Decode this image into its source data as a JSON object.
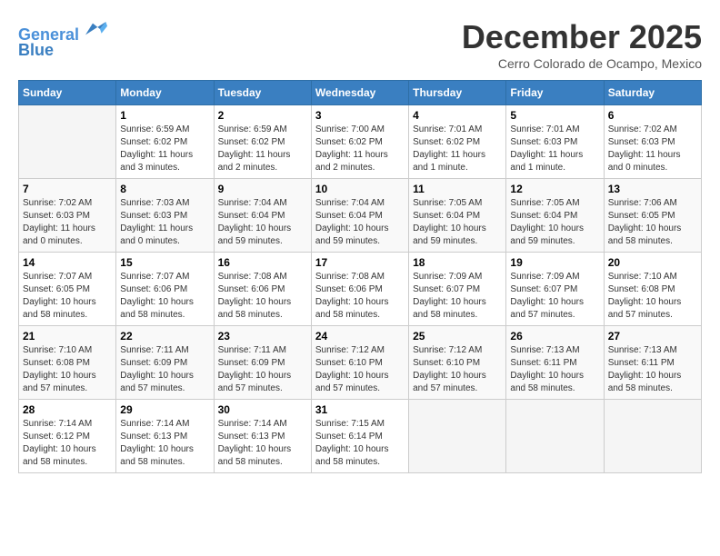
{
  "header": {
    "logo_line1": "General",
    "logo_line2": "Blue",
    "month": "December 2025",
    "location": "Cerro Colorado de Ocampo, Mexico"
  },
  "days_of_week": [
    "Sunday",
    "Monday",
    "Tuesday",
    "Wednesday",
    "Thursday",
    "Friday",
    "Saturday"
  ],
  "weeks": [
    [
      {
        "day": "",
        "sunrise": "",
        "sunset": "",
        "daylight": ""
      },
      {
        "day": "1",
        "sunrise": "Sunrise: 6:59 AM",
        "sunset": "Sunset: 6:02 PM",
        "daylight": "Daylight: 11 hours and 3 minutes."
      },
      {
        "day": "2",
        "sunrise": "Sunrise: 6:59 AM",
        "sunset": "Sunset: 6:02 PM",
        "daylight": "Daylight: 11 hours and 2 minutes."
      },
      {
        "day": "3",
        "sunrise": "Sunrise: 7:00 AM",
        "sunset": "Sunset: 6:02 PM",
        "daylight": "Daylight: 11 hours and 2 minutes."
      },
      {
        "day": "4",
        "sunrise": "Sunrise: 7:01 AM",
        "sunset": "Sunset: 6:02 PM",
        "daylight": "Daylight: 11 hours and 1 minute."
      },
      {
        "day": "5",
        "sunrise": "Sunrise: 7:01 AM",
        "sunset": "Sunset: 6:03 PM",
        "daylight": "Daylight: 11 hours and 1 minute."
      },
      {
        "day": "6",
        "sunrise": "Sunrise: 7:02 AM",
        "sunset": "Sunset: 6:03 PM",
        "daylight": "Daylight: 11 hours and 0 minutes."
      }
    ],
    [
      {
        "day": "7",
        "sunrise": "Sunrise: 7:02 AM",
        "sunset": "Sunset: 6:03 PM",
        "daylight": "Daylight: 11 hours and 0 minutes."
      },
      {
        "day": "8",
        "sunrise": "Sunrise: 7:03 AM",
        "sunset": "Sunset: 6:03 PM",
        "daylight": "Daylight: 11 hours and 0 minutes."
      },
      {
        "day": "9",
        "sunrise": "Sunrise: 7:04 AM",
        "sunset": "Sunset: 6:04 PM",
        "daylight": "Daylight: 10 hours and 59 minutes."
      },
      {
        "day": "10",
        "sunrise": "Sunrise: 7:04 AM",
        "sunset": "Sunset: 6:04 PM",
        "daylight": "Daylight: 10 hours and 59 minutes."
      },
      {
        "day": "11",
        "sunrise": "Sunrise: 7:05 AM",
        "sunset": "Sunset: 6:04 PM",
        "daylight": "Daylight: 10 hours and 59 minutes."
      },
      {
        "day": "12",
        "sunrise": "Sunrise: 7:05 AM",
        "sunset": "Sunset: 6:04 PM",
        "daylight": "Daylight: 10 hours and 59 minutes."
      },
      {
        "day": "13",
        "sunrise": "Sunrise: 7:06 AM",
        "sunset": "Sunset: 6:05 PM",
        "daylight": "Daylight: 10 hours and 58 minutes."
      }
    ],
    [
      {
        "day": "14",
        "sunrise": "Sunrise: 7:07 AM",
        "sunset": "Sunset: 6:05 PM",
        "daylight": "Daylight: 10 hours and 58 minutes."
      },
      {
        "day": "15",
        "sunrise": "Sunrise: 7:07 AM",
        "sunset": "Sunset: 6:06 PM",
        "daylight": "Daylight: 10 hours and 58 minutes."
      },
      {
        "day": "16",
        "sunrise": "Sunrise: 7:08 AM",
        "sunset": "Sunset: 6:06 PM",
        "daylight": "Daylight: 10 hours and 58 minutes."
      },
      {
        "day": "17",
        "sunrise": "Sunrise: 7:08 AM",
        "sunset": "Sunset: 6:06 PM",
        "daylight": "Daylight: 10 hours and 58 minutes."
      },
      {
        "day": "18",
        "sunrise": "Sunrise: 7:09 AM",
        "sunset": "Sunset: 6:07 PM",
        "daylight": "Daylight: 10 hours and 58 minutes."
      },
      {
        "day": "19",
        "sunrise": "Sunrise: 7:09 AM",
        "sunset": "Sunset: 6:07 PM",
        "daylight": "Daylight: 10 hours and 57 minutes."
      },
      {
        "day": "20",
        "sunrise": "Sunrise: 7:10 AM",
        "sunset": "Sunset: 6:08 PM",
        "daylight": "Daylight: 10 hours and 57 minutes."
      }
    ],
    [
      {
        "day": "21",
        "sunrise": "Sunrise: 7:10 AM",
        "sunset": "Sunset: 6:08 PM",
        "daylight": "Daylight: 10 hours and 57 minutes."
      },
      {
        "day": "22",
        "sunrise": "Sunrise: 7:11 AM",
        "sunset": "Sunset: 6:09 PM",
        "daylight": "Daylight: 10 hours and 57 minutes."
      },
      {
        "day": "23",
        "sunrise": "Sunrise: 7:11 AM",
        "sunset": "Sunset: 6:09 PM",
        "daylight": "Daylight: 10 hours and 57 minutes."
      },
      {
        "day": "24",
        "sunrise": "Sunrise: 7:12 AM",
        "sunset": "Sunset: 6:10 PM",
        "daylight": "Daylight: 10 hours and 57 minutes."
      },
      {
        "day": "25",
        "sunrise": "Sunrise: 7:12 AM",
        "sunset": "Sunset: 6:10 PM",
        "daylight": "Daylight: 10 hours and 57 minutes."
      },
      {
        "day": "26",
        "sunrise": "Sunrise: 7:13 AM",
        "sunset": "Sunset: 6:11 PM",
        "daylight": "Daylight: 10 hours and 58 minutes."
      },
      {
        "day": "27",
        "sunrise": "Sunrise: 7:13 AM",
        "sunset": "Sunset: 6:11 PM",
        "daylight": "Daylight: 10 hours and 58 minutes."
      }
    ],
    [
      {
        "day": "28",
        "sunrise": "Sunrise: 7:14 AM",
        "sunset": "Sunset: 6:12 PM",
        "daylight": "Daylight: 10 hours and 58 minutes."
      },
      {
        "day": "29",
        "sunrise": "Sunrise: 7:14 AM",
        "sunset": "Sunset: 6:13 PM",
        "daylight": "Daylight: 10 hours and 58 minutes."
      },
      {
        "day": "30",
        "sunrise": "Sunrise: 7:14 AM",
        "sunset": "Sunset: 6:13 PM",
        "daylight": "Daylight: 10 hours and 58 minutes."
      },
      {
        "day": "31",
        "sunrise": "Sunrise: 7:15 AM",
        "sunset": "Sunset: 6:14 PM",
        "daylight": "Daylight: 10 hours and 58 minutes."
      },
      {
        "day": "",
        "sunrise": "",
        "sunset": "",
        "daylight": ""
      },
      {
        "day": "",
        "sunrise": "",
        "sunset": "",
        "daylight": ""
      },
      {
        "day": "",
        "sunrise": "",
        "sunset": "",
        "daylight": ""
      }
    ]
  ]
}
